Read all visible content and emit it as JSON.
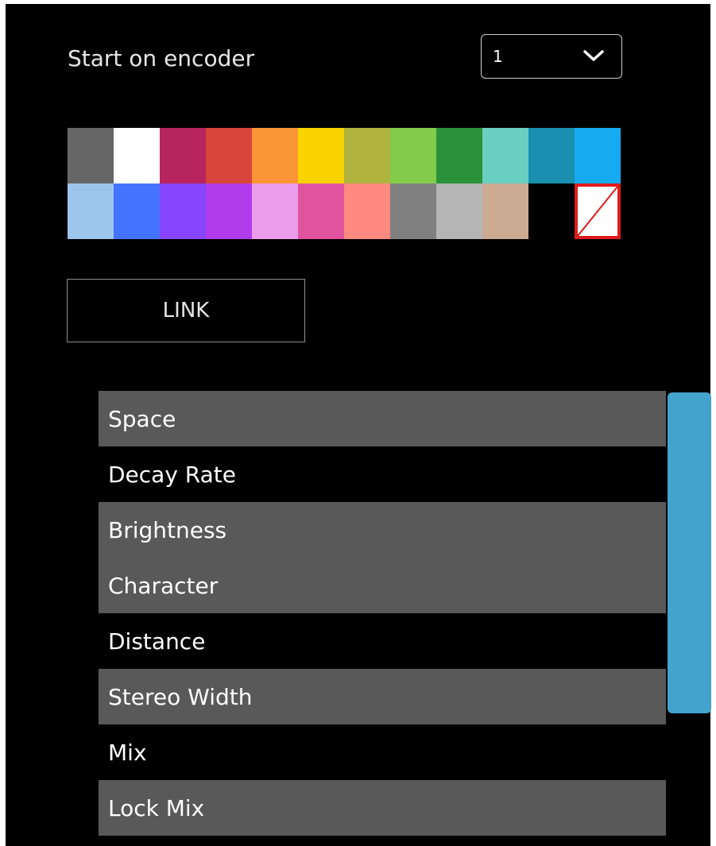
{
  "encoder": {
    "label": "Start on encoder",
    "selected_value": "1",
    "chevron_icon": "chevron-down-icon"
  },
  "palette": {
    "row1": [
      "#666666",
      "#ffffff",
      "#b8245e",
      "#d9443a",
      "#fb9636",
      "#f8d300",
      "#b0b33e",
      "#82cc4a",
      "#2b9239",
      "#6acfc0",
      "#1a8fb0",
      "#16aaf0"
    ],
    "row2": [
      "#9cc6ec",
      "#4473ff",
      "#8746fe",
      "#b13cec",
      "#eb9ceb",
      "#e0539e",
      "#ff8a80",
      "#808080",
      "#b5b5b5",
      "#ccab93",
      "#000000",
      "none"
    ],
    "no_color_icon": "no-color-icon"
  },
  "link_button": {
    "label": "LINK"
  },
  "parameters": [
    {
      "label": "Space",
      "selected": true
    },
    {
      "label": "Decay Rate",
      "selected": false
    },
    {
      "label": "Brightness",
      "selected": true
    },
    {
      "label": "Character",
      "selected": true
    },
    {
      "label": "Distance",
      "selected": false
    },
    {
      "label": "Stereo Width",
      "selected": true
    },
    {
      "label": "Mix",
      "selected": false
    },
    {
      "label": "Lock Mix",
      "selected": true
    }
  ],
  "scrollbar": {
    "color": "#43a3cc"
  }
}
